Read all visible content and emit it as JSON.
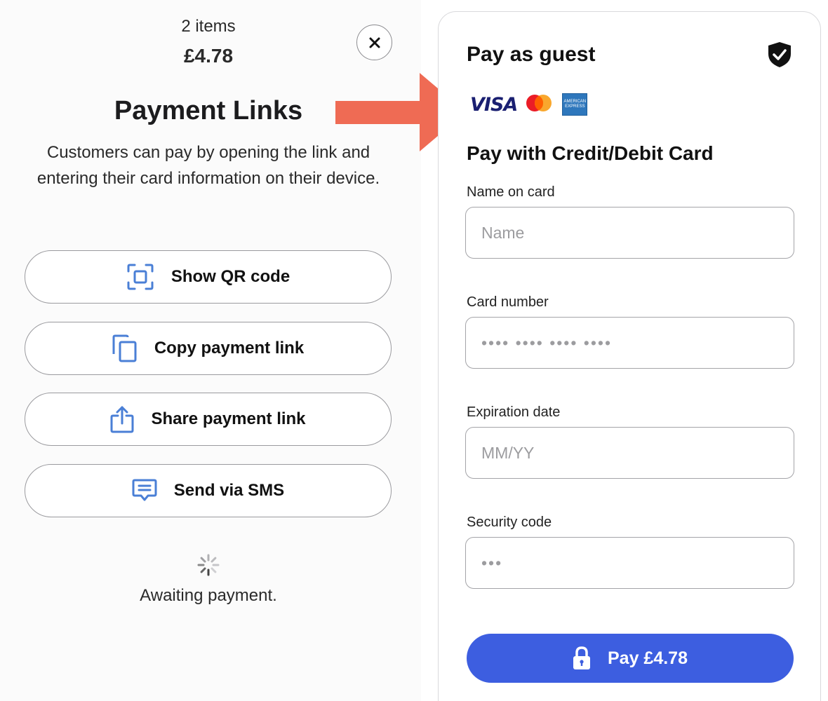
{
  "summary": {
    "items_count": "2 items",
    "total": "£4.78"
  },
  "payment_links": {
    "title": "Payment Links",
    "description": "Customers can pay by opening the link and entering their card information on their device.",
    "buttons": [
      {
        "label": "Show QR code",
        "icon": "qr-code-icon"
      },
      {
        "label": "Copy payment link",
        "icon": "copy-icon"
      },
      {
        "label": "Share payment link",
        "icon": "share-icon"
      },
      {
        "label": "Send via SMS",
        "icon": "message-icon"
      }
    ],
    "status": "Awaiting payment."
  },
  "guest_checkout": {
    "title": "Pay as guest",
    "brands": [
      "VISA",
      "mastercard",
      "AMERICAN EXPRESS"
    ],
    "section_title": "Pay with Credit/Debit Card",
    "fields": {
      "name": {
        "label": "Name on card",
        "placeholder": "Name"
      },
      "card_number": {
        "label": "Card number",
        "placeholder": "•••• •••• •••• ••••"
      },
      "expiration": {
        "label": "Expiration date",
        "placeholder": "MM/YY"
      },
      "security_code": {
        "label": "Security code",
        "placeholder": "•••"
      }
    },
    "pay_button": "Pay £4.78"
  },
  "colors": {
    "accent_blue": "#3d5ee0",
    "icon_blue": "#4a7fd6",
    "arrow": "#ef6b54"
  }
}
